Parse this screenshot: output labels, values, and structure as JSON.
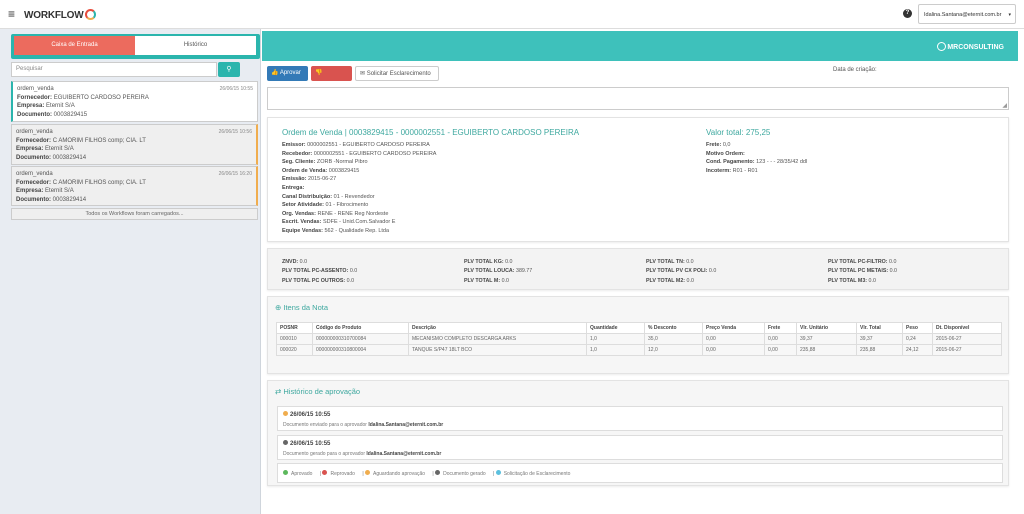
{
  "header": {
    "menu_icon": "hamburger-icon",
    "logo_text": "WORKFLOW",
    "help_icon": "help-icon",
    "user_email": "Idalina.Santana@eternit.com.br",
    "user_caret": "▾"
  },
  "sidebar": {
    "tabs": [
      "Caixa de Entrada",
      "Histórico"
    ],
    "search_placeholder": "Pesquisar",
    "search_icon": "search-icon",
    "items": [
      {
        "type": "ordem_venda",
        "date": "26/06/15 10:55",
        "fornecedor_label": "Fornecedor:",
        "fornecedor": "EGUIBERTO CARDOSO PEREIRA",
        "empresa_label": "Empresa:",
        "empresa": "Eternit S/A",
        "documento_label": "Documento:",
        "documento": "0003829415"
      },
      {
        "type": "ordem_venda",
        "date": "26/06/15 10:56",
        "fornecedor_label": "Fornecedor:",
        "fornecedor": "C AMORIM FILHOS comp; CIA. LT",
        "empresa_label": "Empresa:",
        "empresa": "Eternit S/A",
        "documento_label": "Documento:",
        "documento": "0003829414"
      },
      {
        "type": "ordem_venda",
        "date": "26/06/15 16:20",
        "fornecedor_label": "Fornecedor:",
        "fornecedor": "C AMORIM FILHOS comp; CIA. LT",
        "empresa_label": "Empresa:",
        "empresa": "Eternit S/A",
        "documento_label": "Documento:",
        "documento": "0003829414"
      }
    ],
    "loaded_text": "Todos os Workflows foram carregados..."
  },
  "banner": {
    "brand": "MRCONSULTING"
  },
  "actions": {
    "approve": "Aprovar",
    "reject": "Reprovar",
    "clarify": "Solicitar Esclarecimento",
    "date_label": "Data de criação:"
  },
  "order": {
    "title": "Ordem de Venda | 0003829415 - 0000002551 - EGUIBERTO CARDOSO PEREIRA",
    "total": "Valor total: 275,25",
    "left": [
      {
        "label": "Emissor:",
        "value": "0000002551 - EGUIBERTO CARDOSO PEREIRA"
      },
      {
        "label": "Recebedor:",
        "value": "0000002551 - EGUIBERTO CARDOSO PEREIRA"
      },
      {
        "label": "Seg. Cliente:",
        "value": "ZORB -Normal Pibro"
      },
      {
        "label": "Ordem de Venda:",
        "value": "0003829415"
      },
      {
        "label": "Emissão:",
        "value": "2015-06-27"
      },
      {
        "label": "Entrega:",
        "value": ""
      },
      {
        "label": "Canal Distribuição:",
        "value": "01 - Revendedor"
      },
      {
        "label": "Setor Atividade:",
        "value": "01 - Fibrocimento"
      },
      {
        "label": "Org. Vendas:",
        "value": "RENE - RENE Reg Nordeste"
      },
      {
        "label": "Escrit. Vendas:",
        "value": "SDFE - Unid.Com.Salvador E"
      },
      {
        "label": "Equipe Vendas:",
        "value": "562 - Qualidade Rep. Ltda"
      }
    ],
    "right": [
      {
        "label": "Frete:",
        "value": "0,0"
      },
      {
        "label": "Motivo Ordem:",
        "value": ""
      },
      {
        "label": "Cond. Pagamento:",
        "value": "123 - - - 28/35/42 ddl"
      },
      {
        "label": "Incoterm:",
        "value": "R01 - R01"
      }
    ]
  },
  "plv": [
    {
      "label": "ZNVD:",
      "value": "0.0"
    },
    {
      "label": "PLV TOTAL KG:",
      "value": "0.0"
    },
    {
      "label": "PLV TOTAL TN:",
      "value": "0.0"
    },
    {
      "label": "PLV TOTAL PC-FILTRO:",
      "value": "0.0"
    },
    {
      "label": "PLV TOTAL PC-ASSENTO:",
      "value": "0.0"
    },
    {
      "label": "PLV TOTAL LOUCA:",
      "value": "389.77"
    },
    {
      "label": "PLV TOTAL PV CX POLI:",
      "value": "0.0"
    },
    {
      "label": "PLV TOTAL PC METAIS:",
      "value": "0.0"
    },
    {
      "label": "PLV TOTAL PC OUTROS:",
      "value": "0.0"
    },
    {
      "label": "PLV TOTAL M:",
      "value": "0.0"
    },
    {
      "label": "PLV TOTAL M2:",
      "value": "0.0"
    },
    {
      "label": "PLV TOTAL M3:",
      "value": "0.0"
    }
  ],
  "items": {
    "title": "Itens da Nota",
    "icon": "plus-circle-icon",
    "columns": [
      "POSNR",
      "Código do Produto",
      "Descrição",
      "Quantidade",
      "% Desconto",
      "Preço Venda",
      "Frete",
      "Vlr. Unitário",
      "Vlr. Total",
      "Peso",
      "Dt. Disponível"
    ],
    "rows": [
      [
        "000010",
        "000000000310700084",
        "MECANISMO COMPLETO DESCARGA ARKS",
        "1,0",
        "35,0",
        "0,00",
        "0,00",
        "39,37",
        "39,37",
        "0,24",
        "2015-06-27"
      ],
      [
        "000020",
        "000000000310800004",
        "TANQUE S/P47 18LT BCO",
        "1,0",
        "12,0",
        "0,00",
        "0,00",
        "235,88",
        "235,88",
        "24,12",
        "2015-06-27"
      ]
    ]
  },
  "history": {
    "title": "Histórico de aprovação",
    "icon": "exchange-icon",
    "entries": [
      {
        "date": "26/06/15 10:55",
        "color": "#f0ad4e",
        "text": "Documento enviado para o aprovador",
        "user": "Idalina.Santana@eternit.com.br"
      },
      {
        "date": "26/06/15 10:55",
        "color": "#666666",
        "text": "Documento gerado para o aprovador",
        "user": "Idalina.Santana@eternit.com.br"
      }
    ],
    "legend": [
      {
        "label": "Aprovado",
        "color": "#5cb85c"
      },
      {
        "label": "Reprovado",
        "color": "#d9534f"
      },
      {
        "label": "Aguardando aprovação",
        "color": "#f0ad4e"
      },
      {
        "label": "Documento gerado",
        "color": "#666666"
      },
      {
        "label": "Solicitação de Esclarecimento",
        "color": "#5bc0de"
      }
    ]
  }
}
